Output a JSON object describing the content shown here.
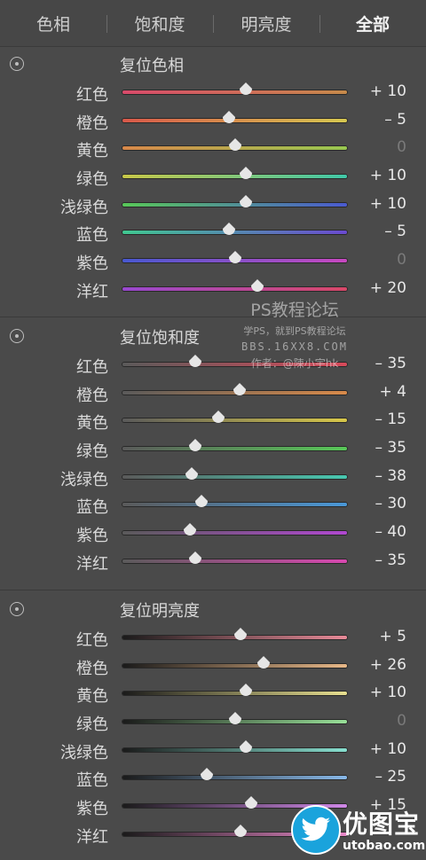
{
  "tabs": [
    {
      "label": "色相",
      "active": false
    },
    {
      "label": "饱和度",
      "active": false
    },
    {
      "label": "明亮度",
      "active": false
    },
    {
      "label": "全部",
      "active": true
    }
  ],
  "sections": [
    {
      "title": "复位色相",
      "rows": [
        {
          "label": "红色",
          "value": "+ 10",
          "num": 10,
          "gradient": [
            "#d84a6a",
            "#c68a4a"
          ]
        },
        {
          "label": "橙色",
          "value": "– 5",
          "num": -5,
          "gradient": [
            "#d8584a",
            "#d6c850"
          ]
        },
        {
          "label": "黄色",
          "value": "0",
          "num": 0,
          "gradient": [
            "#d8884a",
            "#98c850"
          ]
        },
        {
          "label": "绿色",
          "value": "+ 10",
          "num": 10,
          "gradient": [
            "#c8c848",
            "#40c8a8"
          ]
        },
        {
          "label": "浅绿色",
          "value": "+ 10",
          "num": 10,
          "gradient": [
            "#58c858",
            "#4a5ad0"
          ]
        },
        {
          "label": "蓝色",
          "value": "– 5",
          "num": -5,
          "gradient": [
            "#40c890",
            "#6a4ad0"
          ]
        },
        {
          "label": "紫色",
          "value": "0",
          "num": 0,
          "gradient": [
            "#4858d0",
            "#c848c0"
          ]
        },
        {
          "label": "洋红",
          "value": "+ 20",
          "num": 20,
          "gradient": [
            "#9848d0",
            "#d84868"
          ]
        }
      ]
    },
    {
      "title": "复位饱和度",
      "rows": [
        {
          "label": "红色",
          "value": "– 35",
          "num": -35,
          "gradient": [
            "#5a5a5a",
            "#d84a5a"
          ]
        },
        {
          "label": "橙色",
          "value": "+ 4",
          "num": 4,
          "gradient": [
            "#5a5a5a",
            "#d88a4a"
          ]
        },
        {
          "label": "黄色",
          "value": "– 15",
          "num": -15,
          "gradient": [
            "#5a5a5a",
            "#d8c84a"
          ]
        },
        {
          "label": "绿色",
          "value": "– 35",
          "num": -35,
          "gradient": [
            "#5a5a5a",
            "#58c858"
          ]
        },
        {
          "label": "浅绿色",
          "value": "– 38",
          "num": -38,
          "gradient": [
            "#5a5a5a",
            "#48c8b0"
          ]
        },
        {
          "label": "蓝色",
          "value": "– 30",
          "num": -30,
          "gradient": [
            "#5a5a5a",
            "#4a98d8"
          ]
        },
        {
          "label": "紫色",
          "value": "– 40",
          "num": -40,
          "gradient": [
            "#5a5a5a",
            "#b048d0"
          ]
        },
        {
          "label": "洋红",
          "value": "– 35",
          "num": -35,
          "gradient": [
            "#5a5a5a",
            "#d848b0"
          ]
        }
      ]
    },
    {
      "title": "复位明亮度",
      "rows": [
        {
          "label": "红色",
          "value": "+ 5",
          "num": 5,
          "gradient": [
            "#1a1a1a",
            "#e88a98"
          ]
        },
        {
          "label": "橙色",
          "value": "+ 26",
          "num": 26,
          "gradient": [
            "#1a1a1a",
            "#e8b888"
          ]
        },
        {
          "label": "黄色",
          "value": "+ 10",
          "num": 10,
          "gradient": [
            "#1a1a1a",
            "#e8e090"
          ]
        },
        {
          "label": "绿色",
          "value": "0",
          "num": 0,
          "gradient": [
            "#1a1a1a",
            "#98e098"
          ]
        },
        {
          "label": "浅绿色",
          "value": "+ 10",
          "num": 10,
          "gradient": [
            "#1a1a1a",
            "#88e0d0"
          ]
        },
        {
          "label": "蓝色",
          "value": "– 25",
          "num": -25,
          "gradient": [
            "#1a1a1a",
            "#88b8e8"
          ]
        },
        {
          "label": "紫色",
          "value": "+ 15",
          "num": 15,
          "gradient": [
            "#1a1a1a",
            "#d088e8"
          ]
        },
        {
          "label": "洋红",
          "value": "",
          "num": 5,
          "gradient": [
            "#1a1a1a",
            "#e888c8"
          ]
        }
      ]
    }
  ],
  "watermark": {
    "line1": "PS教程论坛",
    "line2": "学PS，就到PS教程论坛",
    "line3": "BBS.16XX8.COM",
    "line4": "作者：@陳小宇hk"
  },
  "logo": {
    "brand": "优图宝",
    "url": "utobao.com",
    "icon": "twitter-bird-icon",
    "color": "#1aa3dc"
  }
}
